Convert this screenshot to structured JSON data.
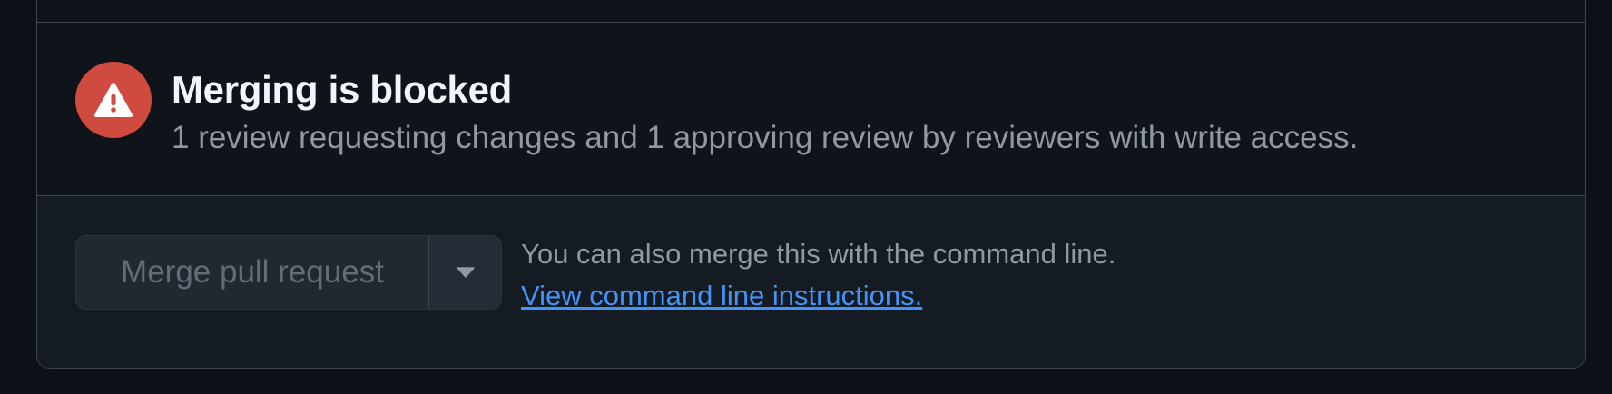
{
  "merge_status": {
    "title": "Merging is blocked",
    "description": "1 review requesting changes and 1 approving review by reviewers with write access.",
    "icon": "alert-icon",
    "icon_color": "#cf4a3f"
  },
  "merge_actions": {
    "merge_button_label": "Merge pull request",
    "dropdown_icon": "triangle-down-icon",
    "cli_text": "You can also merge this with the command line.",
    "cli_link_text": "View command line instructions."
  },
  "colors": {
    "background": "#0d1117",
    "border": "#3d444d",
    "link": "#4493f8",
    "muted_text": "#9198a1"
  }
}
